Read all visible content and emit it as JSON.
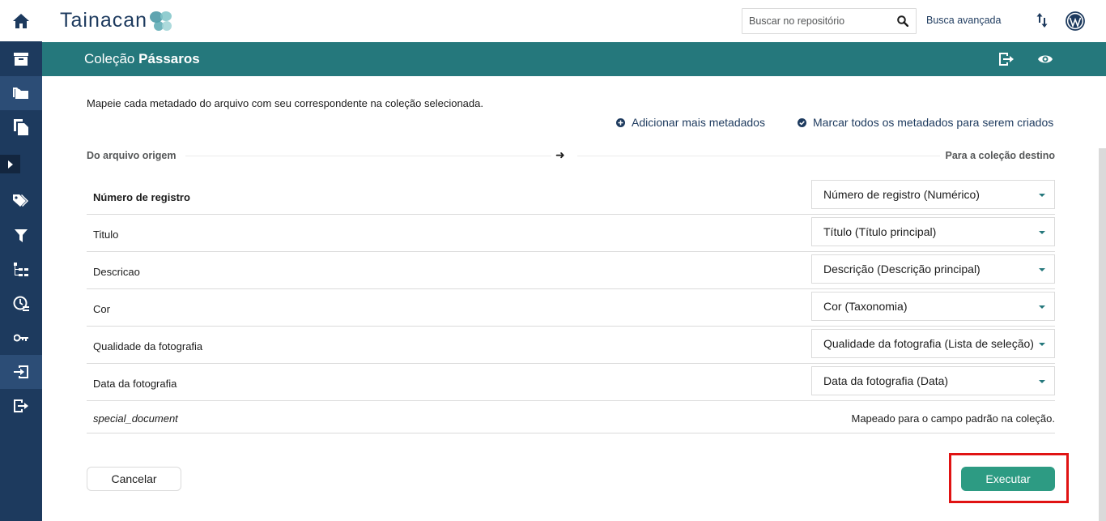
{
  "app": {
    "logo_text": "Tainacan",
    "search_placeholder": "Buscar no repositório",
    "advanced_search": "Busca avançada"
  },
  "header": {
    "title_prefix": "Coleção",
    "title_name": "Pássaros"
  },
  "main": {
    "intro": "Mapeie cada metadado do arquivo com seu correspondente na coleção selecionada.",
    "add_more": "Adicionar mais metadados",
    "mark_all": "Marcar todos os metadados para serem criados",
    "from_label": "Do arquivo origem",
    "to_label": "Para a coleção destino",
    "arrow": "➜",
    "rows": [
      {
        "label": "Número de registro",
        "value": "Número de registro (Numérico)"
      },
      {
        "label": "Titulo",
        "value": "Título (Título principal)"
      },
      {
        "label": "Descricao",
        "value": "Descrição (Descrição principal)"
      },
      {
        "label": "Cor",
        "value": "Cor (Taxonomia)"
      },
      {
        "label": "Qualidade da fotografia",
        "value": "Qualidade da fotografia (Lista de seleção)"
      },
      {
        "label": "Data da fotografia",
        "value": "Data da fotografia (Data)"
      }
    ],
    "special": {
      "label": "special_document",
      "note": "Mapeado para o campo padrão na coleção."
    },
    "cancel": "Cancelar",
    "execute": "Executar"
  },
  "colors": {
    "sidebar": "#1d3a5e",
    "header": "#25787c",
    "primary_button": "#2d9b83",
    "highlight": "#e01313"
  }
}
